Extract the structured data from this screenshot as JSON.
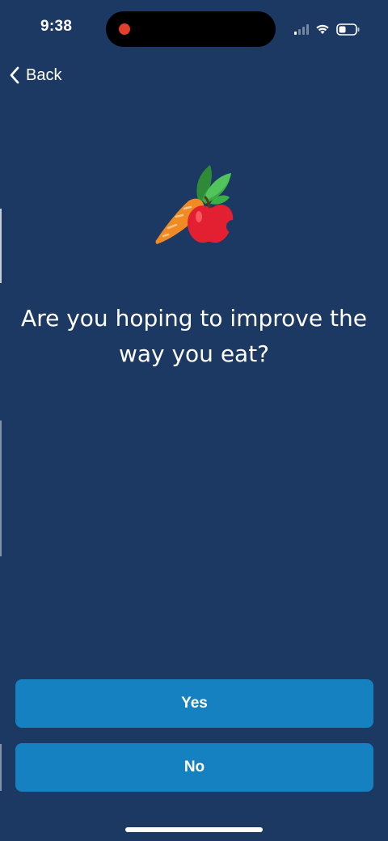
{
  "status_bar": {
    "time": "9:38"
  },
  "nav": {
    "back_label": "Back"
  },
  "icons": {
    "back": "chevron-left-icon",
    "illustration": "carrot-and-apple-icon",
    "signal": "cellular-signal-icon",
    "wifi": "wifi-icon",
    "battery": "battery-icon"
  },
  "question": {
    "text": "Are you hoping to improve the way you eat?"
  },
  "answers": [
    {
      "label": "Yes"
    },
    {
      "label": "No"
    }
  ],
  "colors": {
    "background": "#1c3963",
    "button": "#1681c0",
    "text": "#ffffff",
    "recording_dot": "#e2402c"
  }
}
